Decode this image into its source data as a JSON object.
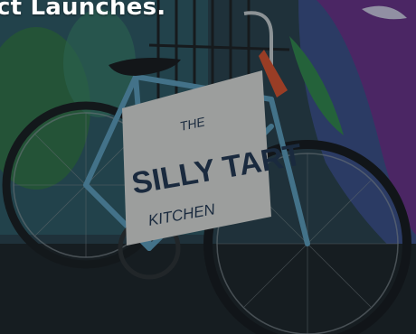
{
  "headline": "ct Launches.",
  "sign": {
    "line1": "THE",
    "line2": "SILLY TART",
    "line3": "KITCHEN"
  },
  "colors": {
    "overlay": "#10181c",
    "headline": "#ffffff",
    "bike_frame": "#5fa4c4",
    "sign_paper": "#e6e6e2",
    "sign_ink": "#1f3550",
    "mural_green": "#2f7a3f",
    "mural_purple": "#6a2f8a"
  }
}
